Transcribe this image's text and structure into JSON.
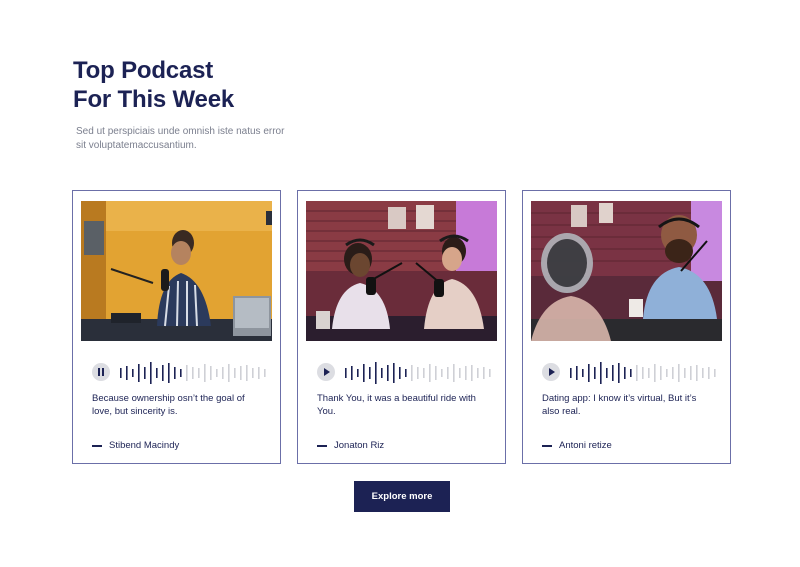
{
  "header": {
    "title_line1": "Top Podcast",
    "title_line2": "For This Week",
    "subtitle": "Sed ut perspiciais unde omnish iste natus error sit voluptatemaccusantium."
  },
  "cards": [
    {
      "state": "pause",
      "progress": 0.45,
      "quote": "Because ownership osn’t the goal of love, but sincerity is.",
      "author": "Stibend Macindy"
    },
    {
      "state": "play",
      "progress": 0.45,
      "quote": "Thank You, it was a beautiful ride with You.",
      "author": "Jonaton Riz"
    },
    {
      "state": "play",
      "progress": 0.45,
      "quote": "Dating app: I know it’s virtual, But it’s also real.",
      "author": "Antoni retize"
    }
  ],
  "cta": {
    "label": "Explore more"
  },
  "colors": {
    "navy": "#1c2254",
    "wave_played": "#1c2254",
    "wave_remaining": "#cfd0d6",
    "card_border": "#6b6fa8"
  }
}
